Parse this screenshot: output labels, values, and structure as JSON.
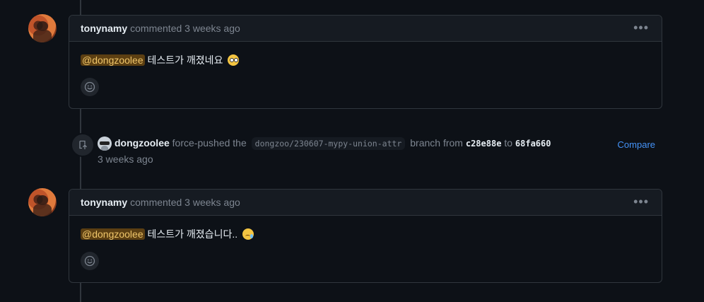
{
  "comments": [
    {
      "author": "tonynamy",
      "meta": "commented 3 weeks ago",
      "mention": "@dongzoolee",
      "text": "테스트가 깨졌네요",
      "emoji": "face-with-spiral-eyes"
    },
    {
      "author": "tonynamy",
      "meta": "commented 3 weeks ago",
      "mention": "@dongzoolee",
      "text": "테스트가 깨졌습니다..",
      "emoji": "face-holding-back-tears"
    }
  ],
  "event": {
    "author": "dongzoolee",
    "action": "force-pushed the",
    "branch": "dongzoo/230607-mypy-union-attr",
    "from_text": "branch from",
    "from_sha": "c28e88e",
    "to_text": "to",
    "to_sha": "68fa660",
    "time": "3 weeks ago",
    "compare_label": "Compare",
    "icon": "repo-push-icon"
  },
  "menu_icon": "kebab-horizontal-icon",
  "reaction_icon": "smiley-icon"
}
